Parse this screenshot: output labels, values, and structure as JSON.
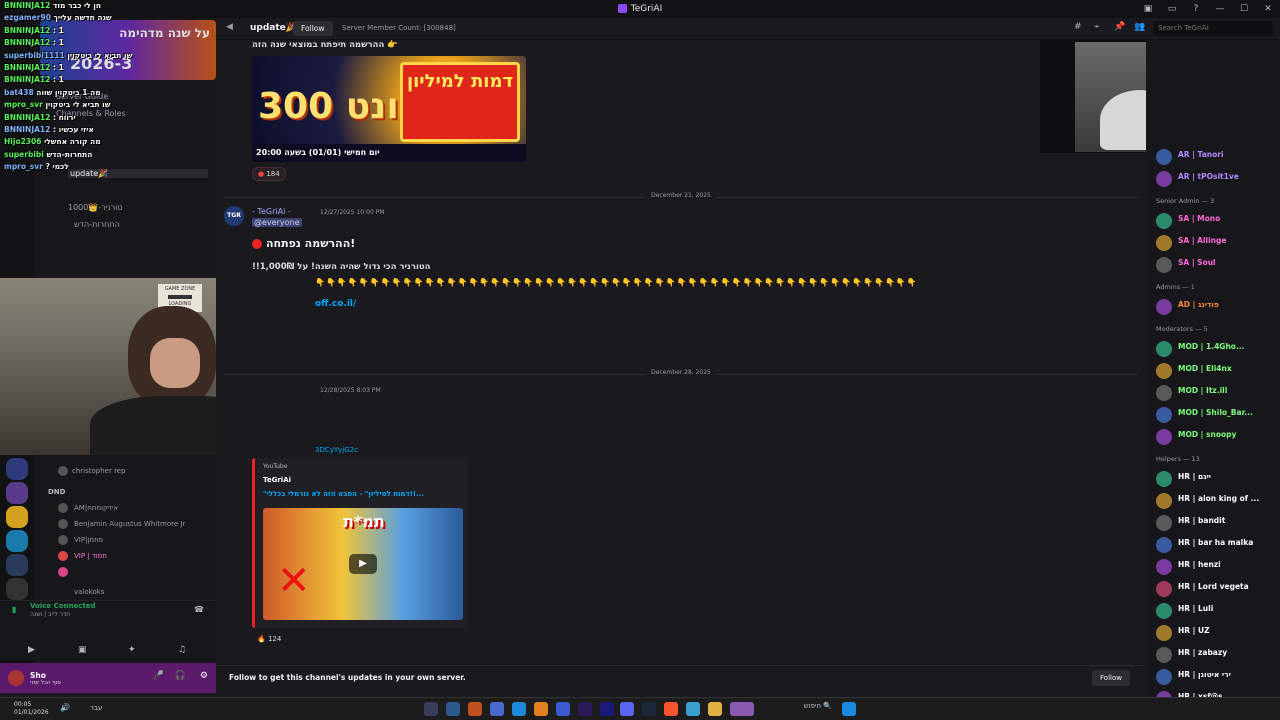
{
  "window": {
    "title": "TeGriAI"
  },
  "header": {
    "channel_name": "update🎉",
    "follow_label": "Follow",
    "member_count": "Server Member Count: [300848]",
    "search_placeholder": "Search TeGriAI"
  },
  "chat_overlay": [
    {
      "user": "BNNINJA12",
      "text": "חן לי כבר מוד"
    },
    {
      "user": "ezgamer90",
      "text": "שנה חדשה עלייך"
    },
    {
      "user": "BNNINJA12",
      "text": ": 1"
    },
    {
      "user": "BNNINJA12",
      "text": ": 1"
    },
    {
      "user": "superbibi1111",
      "text": "שו תביא לי ביטקוין"
    },
    {
      "user": "BNNINJA12",
      "text": ": 1"
    },
    {
      "user": "BNNINJA12",
      "text": ": 1"
    },
    {
      "user": "bat438",
      "text": "מה 1 ביטקוין שווה"
    },
    {
      "user": "mpro_svr",
      "text": "שו תביא לי ביטקוין"
    },
    {
      "user": "BNNINJA12",
      "text": ": ירווח"
    },
    {
      "user": "BNNINJA12",
      "text": ": איזי עכשיו"
    },
    {
      "user": "Hijo2306",
      "text": "מה קורה אחשלי"
    },
    {
      "user": "superbibi",
      "text": "התחרות-הדש"
    },
    {
      "user": "mpro_svr",
      "text": "? לכמי"
    }
  ],
  "promo": {
    "line1": "על שנה מדהימה",
    "line2": "2026-3"
  },
  "webcam_sign": {
    "line1": "GAME ZONE",
    "line2": "LOADING"
  },
  "channels": {
    "server_guide": "Server Guide",
    "channels_roles": "Channels & Roles",
    "update": "update🎉",
    "counter": "1000👑-טורניר",
    "tourn": "התחרות-הדש"
  },
  "left_members": {
    "christopher": "christopher rep",
    "dnd": "DND",
    "am": "AM|איזיקומתח",
    "benjamin": "Benjamin Augustus Whitmore Jr",
    "vip1": "VIP|מוזמן",
    "vip2": "VIP | חמוד",
    "valo": "valokoks"
  },
  "voice": {
    "status": "Voice Connected",
    "channel": "חדר לייב | ושנה"
  },
  "user": {
    "name": "Sho",
    "status": "סוף הכל זמני"
  },
  "messages": {
    "banner_top": "ההרשמה תיפתח במוצאי שנה הזה 👉",
    "banner_big": "איוונט 300K",
    "banner_sign": "דמות למיליון",
    "banner_footer": "20:00 יום חמישי (01/01) בשעה",
    "reaction1": "184",
    "date1": "December 21, 2025",
    "author1": "- TeGriAi -",
    "ts1": "12/27/2025 10:00 PM",
    "mention": "@everyone",
    "headline": "ההרשמה נפתחה!",
    "body": "!!1,000₪ הטורניר הכי גדול שהיה השנה! על",
    "emoji_row": "👇👇👇👇👇👇👇👇👇👇👇👇👇👇👇👇👇👇👇👇👇👇👇👇👇👇👇👇👇👇👇👇👇👇👇👇👇👇👇👇👇👇👇👇👇👇👇👇👇👇👇👇👇👇👇",
    "link": "off.co.il/",
    "date2": "December 28, 2025",
    "ts2": "12/28/2025 8:03 PM",
    "yt_link": "3DCyYyjG2c",
    "embed_provider": "YouTube",
    "embed_author": "TeGriAi",
    "embed_title": "\"דמות למיליון\" - הסבא הזה לא נורמלי בכללי!!...",
    "thumb_text": "תמ*ת",
    "reaction2": "124"
  },
  "footer": {
    "text": "Follow to get this channel's updates in your own server.",
    "button": "Follow"
  },
  "members": [
    {
      "name": "AR | Tanori",
      "color": "#b388ff",
      "role": ""
    },
    {
      "name": "AR | tPOsit1ve",
      "color": "#b388ff",
      "role": ""
    },
    {
      "header": "Senior Admin — 3"
    },
    {
      "name": "SA | Mono",
      "color": "#ff6ad5",
      "role": ""
    },
    {
      "name": "SA | Allinge",
      "color": "#ff6ad5",
      "role": ""
    },
    {
      "name": "SA | Soul",
      "color": "#ff6ad5",
      "role": ""
    },
    {
      "header": "Admins — 1"
    },
    {
      "name": "AD | פודינג",
      "color": "#ff8a3d",
      "role": ""
    },
    {
      "header": "Moderators — 5"
    },
    {
      "name": "MOD | 1.4Gho...",
      "color": "#7dff7d",
      "role": ""
    },
    {
      "name": "MOD | Eli4nx",
      "color": "#7dff7d",
      "role": ""
    },
    {
      "name": "MOD | Itz.ill",
      "color": "#7dff7d",
      "role": ""
    },
    {
      "name": "MOD | Shilo_Bar...",
      "color": "#7dff7d",
      "role": ""
    },
    {
      "name": "MOD | snoopy",
      "color": "#7dff7d",
      "role": ""
    },
    {
      "header": "Helpers — 13"
    },
    {
      "name": "HR | ייגם",
      "color": "#ffffff",
      "role": ""
    },
    {
      "name": "HR | alon king of ...",
      "color": "#ffffff",
      "role": ""
    },
    {
      "name": "HR | bandit",
      "color": "#ffffff",
      "role": ""
    },
    {
      "name": "HR | bar ha malka",
      "color": "#ffffff",
      "role": ""
    },
    {
      "name": "HR | henzi",
      "color": "#ffffff",
      "role": ""
    },
    {
      "name": "HR | Lord vegeta",
      "color": "#ffffff",
      "role": ""
    },
    {
      "name": "HR | Luli",
      "color": "#ffffff",
      "role": ""
    },
    {
      "name": "HR | UZ",
      "color": "#ffffff",
      "role": ""
    },
    {
      "name": "HR | zabazy",
      "color": "#ffffff",
      "role": ""
    },
    {
      "name": "HR | ירי איטונן",
      "color": "#ffffff",
      "role": ""
    },
    {
      "name": "HR | xsf@s",
      "color": "#ffffff",
      "role": ""
    }
  ],
  "taskbar": {
    "time": "00:05",
    "date": "01/01/2026",
    "search": "חיפוש",
    "lang": "עבר"
  }
}
